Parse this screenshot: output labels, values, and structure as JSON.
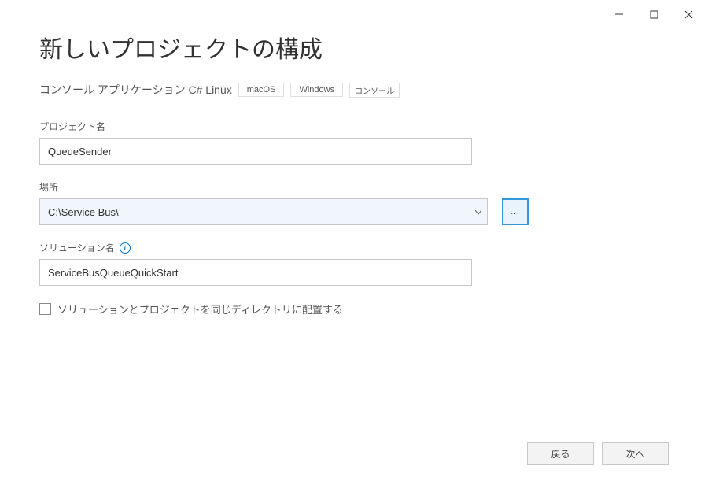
{
  "titlebar": {
    "minimize": "—",
    "maximize": "☐",
    "close": "✕"
  },
  "header": {
    "title": "新しいプロジェクトの構成",
    "subtitle": "コンソール アプリケーション C# Linux",
    "tags": [
      "macOS",
      "Windows",
      "コンソール"
    ]
  },
  "fields": {
    "projectName": {
      "label": "プロジェクト名",
      "value": "QueueSender"
    },
    "location": {
      "label": "場所",
      "value": "C:\\Service Bus\\",
      "browse": "..."
    },
    "solutionName": {
      "label": "ソリューション名",
      "value": "ServiceBusQueueQuickStart"
    },
    "sameDirectory": {
      "label": "ソリューションとプロジェクトを同じディレクトリに配置する"
    }
  },
  "footer": {
    "back": "戻る",
    "next": "次へ"
  }
}
